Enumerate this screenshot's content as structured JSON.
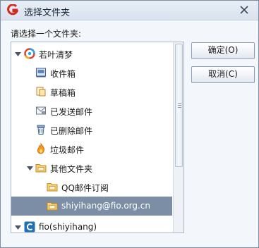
{
  "window": {
    "title": "选择文件夹"
  },
  "prompt": "请选择一个文件夹:",
  "tree": {
    "account1": {
      "name": "若叶清梦",
      "icon": "account-logo-icon"
    },
    "folders": [
      {
        "label": "收件箱",
        "icon": "inbox-icon"
      },
      {
        "label": "草稿箱",
        "icon": "drafts-icon"
      },
      {
        "label": "已发送邮件",
        "icon": "sent-mail-icon"
      },
      {
        "label": "已删除邮件",
        "icon": "trash-icon"
      },
      {
        "label": "垃圾邮件",
        "icon": "spam-icon"
      },
      {
        "label": "其他文件夹",
        "icon": "folder-icon"
      },
      {
        "label": "QQ邮件订阅",
        "icon": "subfolder-icon"
      },
      {
        "label": "shiyihang@fio.org.cn",
        "icon": "subfolder-icon",
        "selected": true
      }
    ],
    "account2": {
      "name": "fio(shiyihang)",
      "icon": "account-c-icon"
    }
  },
  "buttons": {
    "ok": "确定(O)",
    "cancel": "取消(C)"
  },
  "colors": {
    "selection": "#7b8ea5",
    "logo_red": "#d42a1e"
  }
}
